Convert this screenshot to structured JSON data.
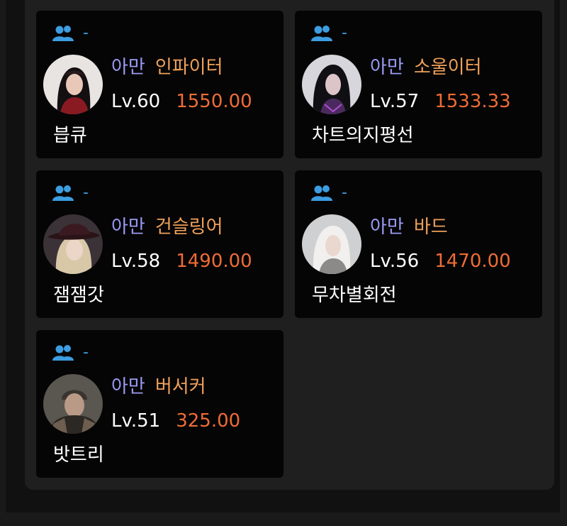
{
  "accent_colors": {
    "party_icon": "#3d9de0",
    "server": "#9b9bf5",
    "class": "#f0a05a",
    "item_level": "#ef6c35"
  },
  "characters": [
    {
      "party_label": "-",
      "avatar_icon": "character-portrait-female-dark-hair-red-outfit",
      "server": "아만",
      "class": "인파이터",
      "level": "Lv.60",
      "item_level": "1550.00",
      "name": "븝큐"
    },
    {
      "party_label": "-",
      "avatar_icon": "character-portrait-female-dark-hair-purple-outfit",
      "server": "아만",
      "class": "소울이터",
      "level": "Lv.57",
      "item_level": "1533.33",
      "name": "차트의지평선"
    },
    {
      "party_label": "-",
      "avatar_icon": "character-portrait-female-blonde-hat",
      "server": "아만",
      "class": "건슬링어",
      "level": "Lv.58",
      "item_level": "1490.00",
      "name": "잼잼갓"
    },
    {
      "party_label": "-",
      "avatar_icon": "character-portrait-female-white-hair",
      "server": "아만",
      "class": "바드",
      "level": "Lv.56",
      "item_level": "1470.00",
      "name": "무차별회전"
    },
    {
      "party_label": "-",
      "avatar_icon": "character-portrait-male-armored",
      "server": "아만",
      "class": "버서커",
      "level": "Lv.51",
      "item_level": "325.00",
      "name": "밧트리"
    }
  ]
}
